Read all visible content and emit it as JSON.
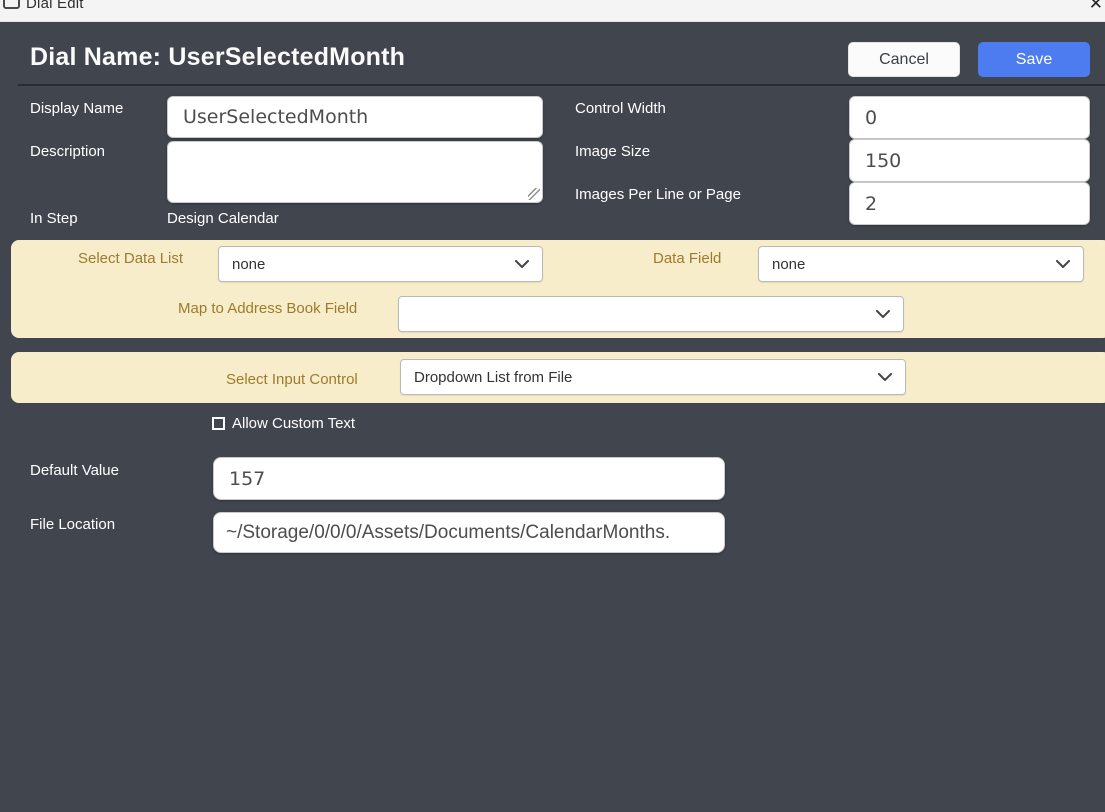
{
  "window": {
    "title": "Dial Edit",
    "close_glyph": "✕"
  },
  "header": {
    "title": "Dial Name: UserSelectedMonth",
    "cancel_label": "Cancel",
    "save_label": "Save"
  },
  "form": {
    "display_name": {
      "label": "Display Name",
      "value": "UserSelectedMonth"
    },
    "description": {
      "label": "Description",
      "value": ""
    },
    "in_step": {
      "label": "In Step",
      "value": "Design Calendar"
    },
    "control_width": {
      "label": "Control Width",
      "value": "0"
    },
    "image_size": {
      "label": "Image Size",
      "value": "150"
    },
    "images_per_line_or_page": {
      "label": "Images Per Line or Page",
      "value": "2"
    }
  },
  "data_mapping_section": {
    "select_data_list": {
      "label": "Select Data List",
      "selected": "none"
    },
    "data_field": {
      "label": "Data Field",
      "selected": "none"
    },
    "map_to_address_book_field": {
      "label": "Map to Address Book Field",
      "selected": ""
    }
  },
  "input_control_section": {
    "select_input_control": {
      "label": "Select Input Control",
      "selected": "Dropdown List from File"
    }
  },
  "value_section": {
    "allow_custom_text": {
      "label": "Allow Custom Text",
      "checked": false
    },
    "default_value": {
      "label": "Default Value",
      "value": "157"
    },
    "file_location": {
      "label": "File Location",
      "value": "~/Storage/0/0/0/Assets/Documents/CalendarMonths."
    }
  },
  "colors": {
    "panel_dark": "#41454e",
    "accent_blue": "#4d7cf0",
    "section_cream": "#f8edca",
    "cream_label": "#9d7b2d"
  }
}
